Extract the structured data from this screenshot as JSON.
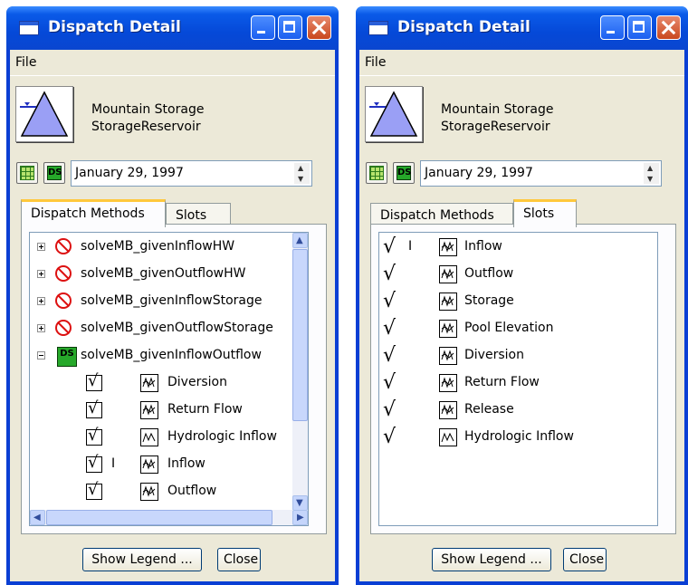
{
  "windows": [
    {
      "title": "Dispatch Detail",
      "menu": [
        "File"
      ],
      "object": {
        "name": "Mountain Storage",
        "type": "StorageReservoir"
      },
      "date": "January 29, 1997",
      "tabs": [
        {
          "label": "Dispatch Methods",
          "active": true
        },
        {
          "label": "Slots",
          "active": false
        }
      ],
      "methods": [
        {
          "name": "solveMB_givenInflowHW",
          "expanded": false,
          "status": "inactive"
        },
        {
          "name": "solveMB_givenOutflowHW",
          "expanded": false,
          "status": "inactive"
        },
        {
          "name": "solveMB_givenInflowStorage",
          "expanded": false,
          "status": "inactive"
        },
        {
          "name": "solveMB_givenOutflowStorage",
          "expanded": false,
          "status": "inactive"
        },
        {
          "name": "solveMB_givenInflowOutflow",
          "expanded": true,
          "status": "dispatch"
        }
      ],
      "method_slots": [
        {
          "name": "Diversion",
          "flag": ""
        },
        {
          "name": "Return Flow",
          "flag": ""
        },
        {
          "name": "Hydrologic Inflow",
          "flag": ""
        },
        {
          "name": "Inflow",
          "flag": "I"
        },
        {
          "name": "Outflow",
          "flag": ""
        }
      ],
      "buttons": {
        "legend": "Show Legend ...",
        "close": "Close"
      }
    },
    {
      "title": "Dispatch Detail",
      "menu": [
        "File"
      ],
      "object": {
        "name": "Mountain Storage",
        "type": "StorageReservoir"
      },
      "date": "January 29, 1997",
      "tabs": [
        {
          "label": "Dispatch Methods",
          "active": false
        },
        {
          "label": "Slots",
          "active": true
        }
      ],
      "slots": [
        {
          "name": "Inflow",
          "flag": "I"
        },
        {
          "name": "Outflow",
          "flag": ""
        },
        {
          "name": "Storage",
          "flag": ""
        },
        {
          "name": "Pool Elevation",
          "flag": ""
        },
        {
          "name": "Diversion",
          "flag": ""
        },
        {
          "name": "Return Flow",
          "flag": ""
        },
        {
          "name": "Release",
          "flag": ""
        },
        {
          "name": "Hydrologic Inflow",
          "flag": ""
        }
      ],
      "buttons": {
        "legend": "Show Legend ...",
        "close": "Close"
      }
    }
  ],
  "icons": {
    "window": "window-icon",
    "reservoir": "reservoir-triangle-icon",
    "grid": "grid-icon",
    "dispatch": "ds-icon",
    "inactive": "no-dispatch-icon",
    "slot": "series-slot-icon",
    "check": "checkmark-icon"
  },
  "colors": {
    "titlebar": "#0a3fd4",
    "accent_tab": "#ffc83c",
    "close_button": "#c9481e",
    "reservoir_fill": "#9a9ff5",
    "ds_green": "#26a82a"
  }
}
